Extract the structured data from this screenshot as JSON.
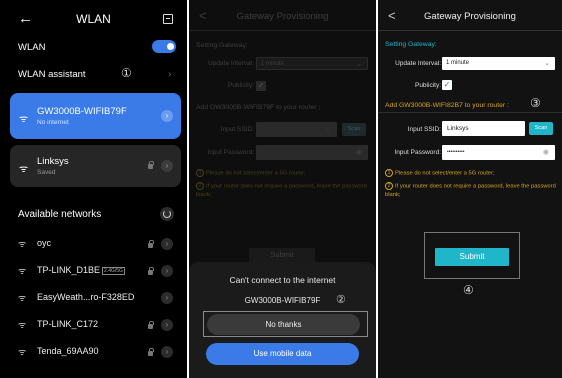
{
  "panel1": {
    "header": {
      "back_glyph": "←",
      "title": "WLAN"
    },
    "wlan_label": "WLAN",
    "wlan_toggle_on": true,
    "assistant_label": "WLAN assistant",
    "marker": "①",
    "connected": {
      "name": "GW3000B-WIFIB79F",
      "status": "No internet"
    },
    "saved": {
      "name": "Linksys",
      "status": "Saved"
    },
    "available_title": "Available networks",
    "networks": [
      {
        "name": "oyc",
        "tag": "",
        "locked": true
      },
      {
        "name": "TP-LINK_D1BE",
        "tag": "2.4G/5G",
        "locked": true
      },
      {
        "name": "EasyWeath...ro-F328ED",
        "tag": "",
        "locked": false
      },
      {
        "name": "TP-LINK_C172",
        "tag": "",
        "locked": true
      },
      {
        "name": "Tenda_69AA90",
        "tag": "",
        "locked": true
      }
    ]
  },
  "panel2": {
    "header": {
      "back_glyph": "<",
      "title": "Gateway Provisioning"
    },
    "setting_gateway": "Setting Gateway:",
    "update_interval_label": "Update Interval:",
    "update_interval_value": "1 minute",
    "publicity_label": "Publicity:",
    "add_title": "Add GW3000B-WIFIB79F to your router :",
    "input_ssid_label": "Input SSID:",
    "scan_label": "Scan",
    "input_password_label": "Input Password:",
    "note1": "Please do not select/enter a 5G router;",
    "note2": "If your router does not require a password, leave the password blank;",
    "submit_label": "Submit",
    "dialog": {
      "title": "Can't connect to the internet",
      "network": "GW3000B-WIFIB79F",
      "marker": "②",
      "no_thanks": "No thanks",
      "use_mobile": "Use mobile data"
    }
  },
  "panel3": {
    "header": {
      "back_glyph": "<",
      "title": "Gateway Provisioning"
    },
    "setting_gateway": "Setting Gateway:",
    "update_interval_label": "Update Interval:",
    "update_interval_value": "1 minute",
    "publicity_label": "Publicity:",
    "add_title": "Add GW3000B-WIFI82B7 to your router :",
    "marker3": "③",
    "input_ssid_label": "Input SSID:",
    "ssid_value": "Linksys",
    "scan_label": "Scan",
    "input_password_label": "Input Password:",
    "password_value": "••••••••••",
    "note1": "Please do not select/enter a 5G router;",
    "note2": "If your router does not require a password, leave the password blank;",
    "submit_label": "Submit",
    "marker4": "④"
  },
  "colors": {
    "accent_blue": "#3a7be8",
    "teal": "#1fb6c9",
    "note_yellow": "#d9a520"
  }
}
